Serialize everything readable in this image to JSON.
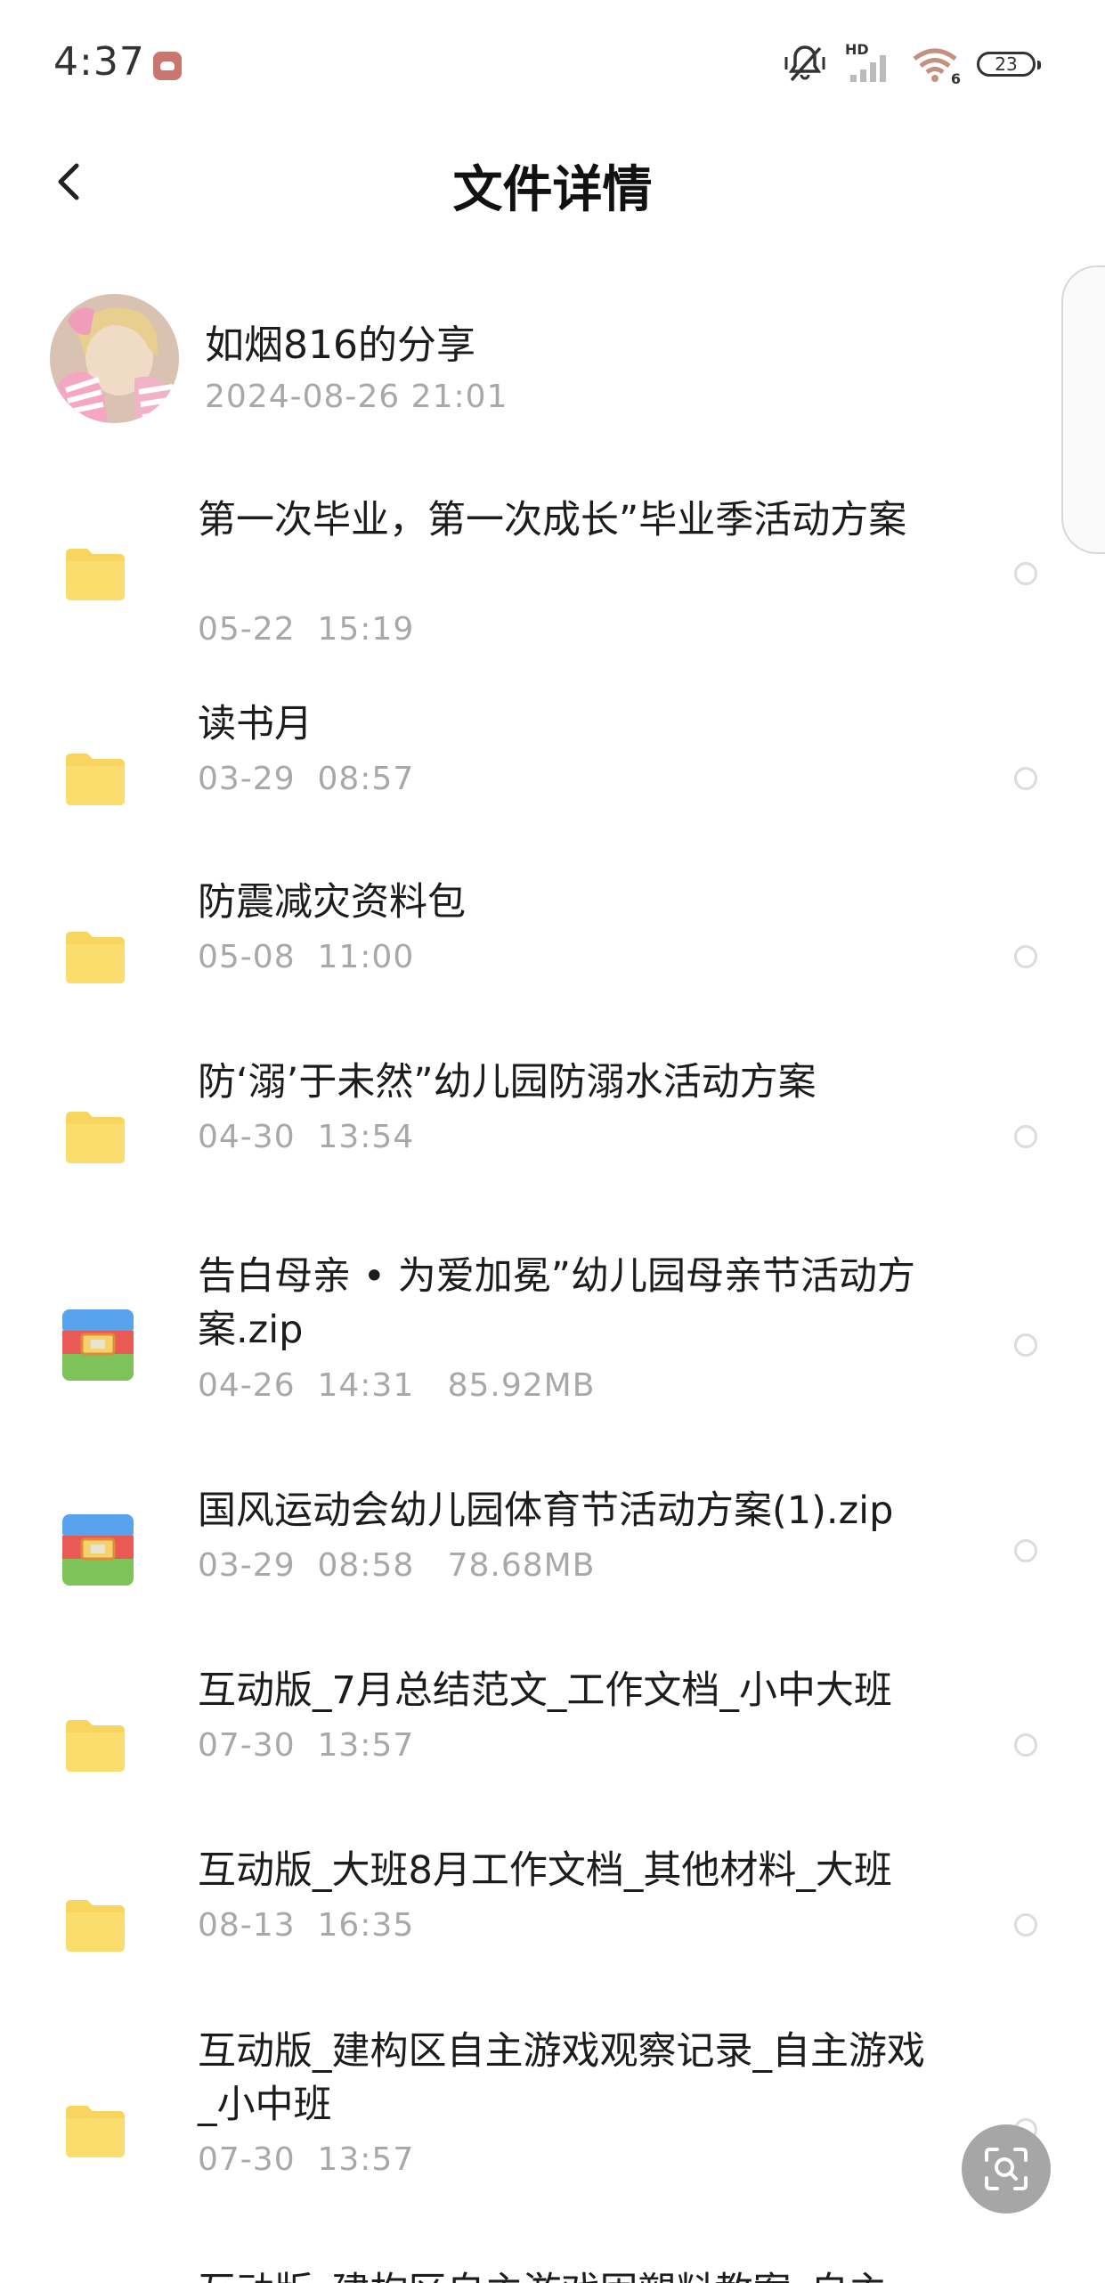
{
  "status_bar": {
    "time": "4:37",
    "signal_label": "HD",
    "wifi_label": "6",
    "battery": "23"
  },
  "header": {
    "title": "文件详情"
  },
  "sharer": {
    "name": "如烟816的分享",
    "date": "2024-08-26  21:01"
  },
  "files": [
    {
      "type": "folder",
      "name": "第一次毕业，第一次成长”毕业季活动方案",
      "meta": "05-22  15:19"
    },
    {
      "type": "folder",
      "name": "读书月",
      "meta": "03-29  08:57"
    },
    {
      "type": "folder",
      "name": "防震减灾资料包",
      "meta": "05-08  11:00"
    },
    {
      "type": "folder",
      "name": "防‘溺’于未然”幼儿园防溺水活动方案",
      "meta": "04-30  13:54"
    },
    {
      "type": "zip",
      "name": "告白母亲 • 为爱加冕”幼儿园母亲节活动方案.zip",
      "meta": "04-26  14:31   85.92MB"
    },
    {
      "type": "zip",
      "name": "国风运动会幼儿园体育节活动方案(1).zip",
      "meta": "03-29  08:58   78.68MB"
    },
    {
      "type": "folder",
      "name": "互动版_7月总结范文_工作文档_小中大班",
      "meta": "07-30  13:57"
    },
    {
      "type": "folder",
      "name": "互动版_大班8月工作文档_其他材料_大班",
      "meta": "08-13  16:35"
    },
    {
      "type": "folder",
      "name": "互动版_建构区自主游戏观察记录_自主游戏_小中班",
      "meta": "07-30  13:57"
    },
    {
      "type": "folder",
      "name": "互动版_建构区自主游戏固塑料教案_自主",
      "meta": ""
    }
  ],
  "colors": {
    "folder": "#f8d55f",
    "zip_red": "#ea5a55",
    "zip_blue": "#57a3ee",
    "zip_green": "#7dc35a",
    "meta_text": "#a8a8a8"
  },
  "icons": {
    "back": "chevron-left-icon",
    "search_fab": "scan-search-icon",
    "folder": "folder-icon",
    "zip": "archive-icon"
  }
}
